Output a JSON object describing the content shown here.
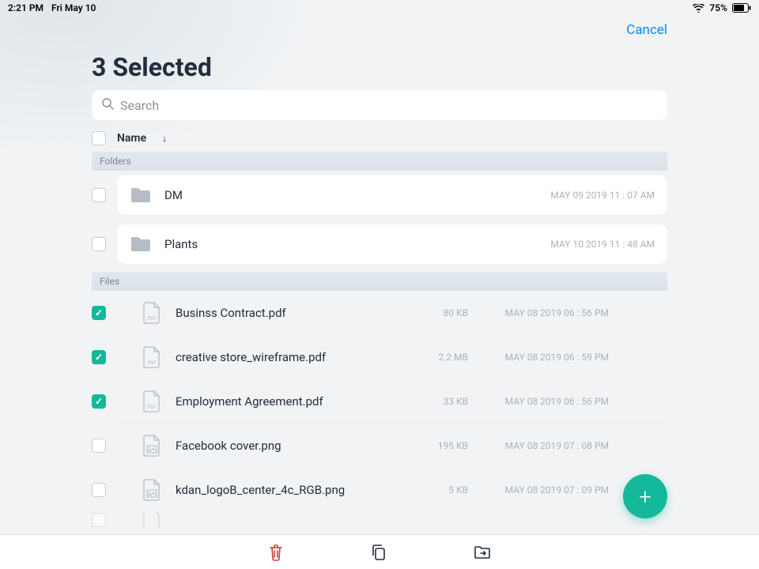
{
  "status": {
    "time": "2:21 PM",
    "date": "Fri May 10",
    "battery_pct": "75%"
  },
  "header": {
    "cancel": "Cancel",
    "title": "3 Selected"
  },
  "search": {
    "placeholder": "Search"
  },
  "list_header": {
    "name_col": "Name"
  },
  "sections": {
    "folders_label": "Folders",
    "files_label": "Files"
  },
  "folders": [
    {
      "name": "DM",
      "date": "MAY 09 2019 11 : 07 AM",
      "checked": false
    },
    {
      "name": "Plants",
      "date": "MAY 10 2019 11 : 48 AM",
      "checked": false
    }
  ],
  "files": [
    {
      "name": "Businss Contract.pdf",
      "size": "80 KB",
      "date": "MAY 08 2019 06 : 56 PM",
      "type": "pdf",
      "checked": true
    },
    {
      "name": "creative store_wireframe.pdf",
      "size": "2.2 MB",
      "date": "MAY 08 2019 06 : 59 PM",
      "type": "pdf",
      "checked": true
    },
    {
      "name": "Employment Agreement.pdf",
      "size": "33 KB",
      "date": "MAY 08 2019 06 : 56 PM",
      "type": "pdf",
      "checked": true
    },
    {
      "name": "Facebook cover.png",
      "size": "195 KB",
      "date": "MAY 08 2019 07 : 08 PM",
      "type": "img",
      "checked": false
    },
    {
      "name": "kdan_logoB_center_4c_RGB.png",
      "size": "5 KB",
      "date": "MAY 08 2019 07 : 09 PM",
      "type": "img",
      "checked": false
    }
  ],
  "colors": {
    "accent": "#14b89a",
    "link": "#0a84ff",
    "delete": "#d63a34"
  }
}
